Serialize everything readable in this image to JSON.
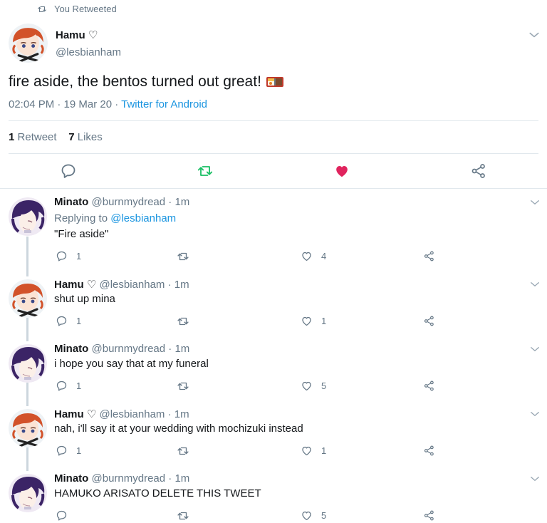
{
  "banner": {
    "label": "You Retweeted"
  },
  "main_tweet": {
    "name": "Hamu ♡",
    "handle": "@lesbianham",
    "text": "fire aside, the bentos turned out great!",
    "time": "02:04 PM · 19 Mar 20 · ",
    "client": "Twitter for Android",
    "retweet_count": "1",
    "retweet_label": "Retweet",
    "like_count": "7",
    "like_label": "Likes"
  },
  "replies": [
    {
      "name": "Minato",
      "handle": "@burnmydread",
      "time": "· 1m",
      "replying_prefix": "Replying to ",
      "replying_handle": "@lesbianham",
      "text": "\"Fire aside\"",
      "reply_count": "1",
      "like_count": "4",
      "avatar": "minato"
    },
    {
      "name": "Hamu ♡",
      "handle": "@lesbianham",
      "time": "· 1m",
      "text": "shut up mina",
      "reply_count": "1",
      "like_count": "1",
      "avatar": "hamu"
    },
    {
      "name": "Minato",
      "handle": "@burnmydread",
      "time": "· 1m",
      "text": "i hope you say that at my funeral",
      "reply_count": "1",
      "like_count": "5",
      "avatar": "minato"
    },
    {
      "name": "Hamu ♡",
      "handle": "@lesbianham",
      "time": "· 1m",
      "text": "nah, i'll say it at your wedding with mochizuki instead",
      "reply_count": "1",
      "like_count": "1",
      "avatar": "hamu"
    },
    {
      "name": "Minato",
      "handle": "@burnmydread",
      "time": "· 1m",
      "text": "HAMUKO ARISATO DELETE THIS TWEET",
      "reply_count": "",
      "like_count": "5",
      "avatar": "minato"
    }
  ],
  "colors": {
    "accent": "#1b95e0",
    "retweet_active": "#17bf63",
    "like_active": "#e0245e",
    "icon_grey": "#657786",
    "divider": "#e1e8ed"
  },
  "icons": {
    "banner": "retweet-icon",
    "reply": "reply-icon",
    "retweet": "retweet-icon",
    "like": "heart-icon",
    "share": "share-icon",
    "menu": "chevron-down-icon",
    "emoji": "bento-box-emoji"
  }
}
